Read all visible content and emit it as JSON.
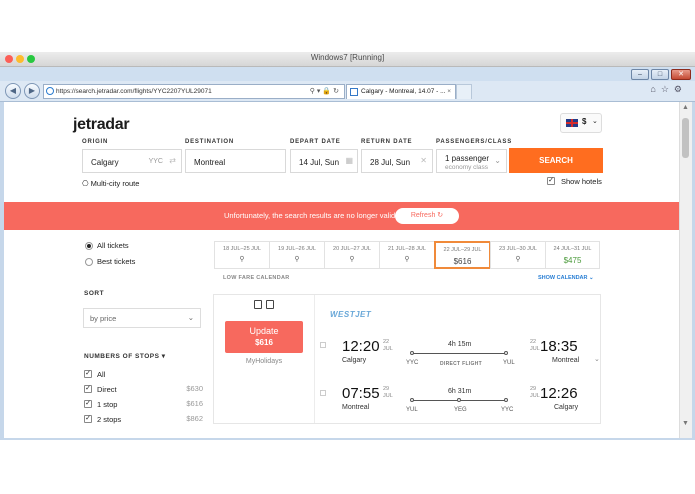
{
  "host_window": {
    "title": "Windows7 [Running]"
  },
  "browser": {
    "url": "https://search.jetradar.com/flights/YYC2207YUL29071",
    "tab_title": "Calgary - Montreal, 14.07 - ...",
    "tab_close": "×"
  },
  "site": {
    "logo": "jetradar",
    "currency": "$"
  },
  "search_form": {
    "origin_label": "ORIGIN",
    "origin_value": "Calgary",
    "origin_code": "YYC",
    "destination_label": "DESTINATION",
    "destination_value": "Montreal",
    "depart_label": "DEPART DATE",
    "depart_value": "14 Jul, Sun",
    "return_label": "RETURN DATE",
    "return_value": "28 Jul, Sun",
    "passengers_label": "PASSENGERS/CLASS",
    "passengers_value": "1 passenger",
    "class_value": "economy class",
    "search_button": "SEARCH",
    "multi_city": "Multi-city route",
    "show_hotels": "Show hotels"
  },
  "banner": {
    "message": "Unfortunately, the search results are no longer valid.",
    "refresh_label": "Refresh"
  },
  "sidebar": {
    "ticket_options": [
      "All tickets",
      "Best tickets"
    ],
    "sort_label": "SORT",
    "sort_value": "by price",
    "stops_label": "NUMBERS OF STOPS",
    "stops": [
      {
        "label": "All",
        "price": ""
      },
      {
        "label": "Direct",
        "price": "$630"
      },
      {
        "label": "1 stop",
        "price": "$616"
      },
      {
        "label": "2 stops",
        "price": "$862"
      }
    ]
  },
  "calendar": {
    "cells": [
      {
        "dates": "18 JUL–25 JUL",
        "price": ""
      },
      {
        "dates": "19 JUL–26 JUL",
        "price": ""
      },
      {
        "dates": "20 JUL–27 JUL",
        "price": ""
      },
      {
        "dates": "21 JUL–28 JUL",
        "price": ""
      },
      {
        "dates": "22 JUL–29 JUL",
        "price": "$616"
      },
      {
        "dates": "23 JUL–30 JUL",
        "price": ""
      },
      {
        "dates": "24 JUL–31 JUL",
        "price": "$475"
      }
    ],
    "low_fare_label": "LOW FARE CALENDAR",
    "show_calendar_label": "SHOW CALENDAR"
  },
  "result": {
    "update_label": "Update",
    "price": "$616",
    "agent": "MyHolidays",
    "airline": "WESTJET",
    "outbound": {
      "dep_time": "12:20",
      "dep_day": "22",
      "dep_month": "JUL",
      "dep_city": "Calgary",
      "dep_code": "YYC",
      "duration": "4h 15m",
      "note": "DIRECT FLIGHT",
      "arr_time": "18:35",
      "arr_day": "22",
      "arr_month": "JUL",
      "arr_city": "Montreal",
      "arr_code": "YUL"
    },
    "inbound": {
      "dep_time": "07:55",
      "dep_day": "29",
      "dep_month": "JUL",
      "dep_city": "Montreal",
      "dep_code": "YUL",
      "duration": "6h 31m",
      "stop_code": "YEG",
      "arr_time": "12:26",
      "arr_day": "29",
      "arr_month": "JUL",
      "arr_city": "Calgary",
      "arr_code": "YYC"
    }
  }
}
